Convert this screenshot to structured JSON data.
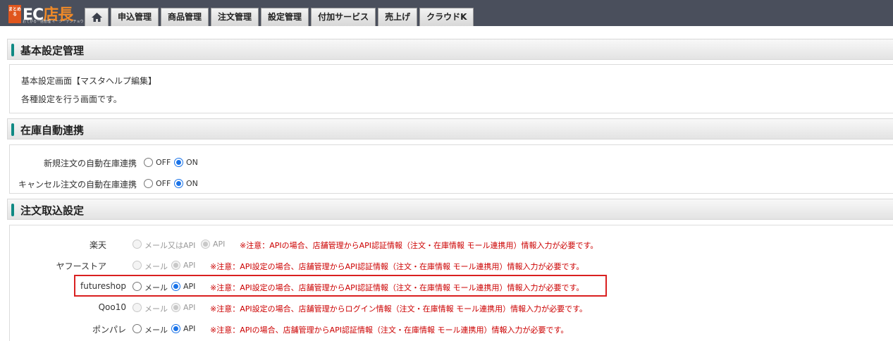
{
  "logo": {
    "badge": "まとめる",
    "main_prefix": "EC",
    "main_suffix": "店長",
    "sub": "おてがる一括管理 イーシーテンチョウ"
  },
  "nav": {
    "home_icon": "home-icon",
    "tabs": [
      "申込管理",
      "商品管理",
      "注文管理",
      "設定管理",
      "付加サービス",
      "売上げ",
      "クラウドK"
    ]
  },
  "basic": {
    "title": "基本設定管理",
    "line1": "基本設定画面【マスタヘルプ編集】",
    "line2": "各種設定を行う画面です。"
  },
  "stock": {
    "title": "在庫自動連携",
    "rows": [
      {
        "label": "新規注文の自動在庫連携",
        "off": "OFF",
        "on": "ON",
        "selected": "ON"
      },
      {
        "label": "キャンセル注文の自動在庫連携",
        "off": "OFF",
        "on": "ON",
        "selected": "ON"
      }
    ]
  },
  "order": {
    "title": "注文取込設定",
    "rows": [
      {
        "label": "楽天",
        "opt1": "メール又はAPI",
        "opt2": "API",
        "selected": "API",
        "disabled": true,
        "note": "※注意：APIの場合、店舗管理からAPI認証情報（注文・在庫情報 モール連携用）情報入力が必要です。"
      },
      {
        "label": "ヤフーストア",
        "opt1": "メール",
        "opt2": "API",
        "selected": "API",
        "disabled": true,
        "note": "※注意：API設定の場合、店舗管理からAPI認証情報（注文・在庫情報 モール連携用）情報入力が必要です。"
      },
      {
        "label": "futureshop",
        "opt1": "メール",
        "opt2": "API",
        "selected": "API",
        "disabled": false,
        "note": "※注意：API設定の場合、店舗管理からAPI認証情報（注文・在庫情報 モール連携用）情報入力が必要です。"
      },
      {
        "label": "Qoo10",
        "opt1": "メール",
        "opt2": "API",
        "selected": "API",
        "disabled": true,
        "note": "※注意：API設定の場合、店舗管理からログイン情報（注文・在庫情報 モール連携用）情報入力が必要です。"
      },
      {
        "label": "ポンパレ",
        "opt1": "メール",
        "opt2": "API",
        "selected": "API",
        "disabled": false,
        "note": "※注意：APIの場合、店舗管理からAPI認証情報（注文・在庫情報 モール連携用）情報入力が必要です。"
      }
    ]
  },
  "colors": {
    "topbar": "#4a4f5c",
    "accent": "#0f8a84",
    "note": "#cc0000",
    "highlight": "#d92020",
    "radio": "#1a73e8"
  }
}
